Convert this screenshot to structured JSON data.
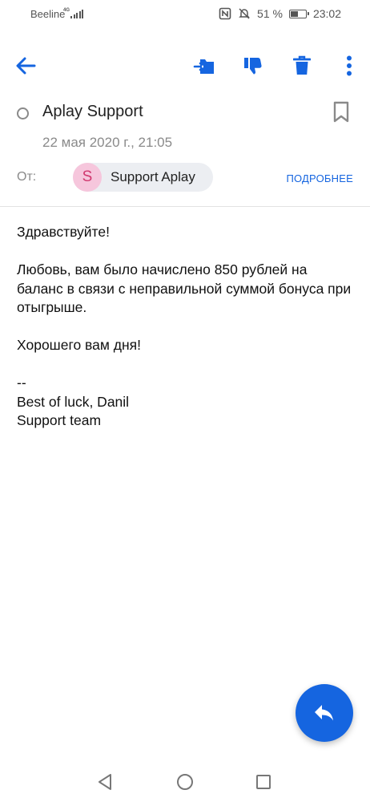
{
  "status_bar": {
    "carrier": "Beeline",
    "network": "4G",
    "nfc_icon": "nfc-icon",
    "mute_icon": "bell-off-icon",
    "battery_percent": "51 %",
    "battery_level": 0.51,
    "time": "23:02"
  },
  "toolbar": {
    "back_icon": "arrow-left-icon",
    "move_icon": "move-to-folder-icon",
    "spam_icon": "thumbs-down-icon",
    "delete_icon": "trash-icon",
    "more_icon": "more-vertical-icon"
  },
  "email": {
    "subject": "Aplay Support",
    "date": "22 мая 2020 г., 21:05",
    "from_label": "От:",
    "sender_initial": "S",
    "sender_name": "Support Aplay",
    "details_link": "ПОДРОБНЕЕ",
    "body": {
      "greeting": "Здравствуйте!",
      "paragraph": "Любовь, вам было начислено 850 рублей на баланс в связи с неправильной суммой бонуса при отыгрыше.",
      "wish": "Хорошего вам дня!",
      "sig_sep": "--",
      "sig_line1": "Best of luck, Danil",
      "sig_line2": "Support team"
    }
  },
  "fab": {
    "icon": "reply-icon"
  },
  "navbar": {
    "back_icon": "triangle-back-icon",
    "home_icon": "circle-home-icon",
    "recents_icon": "square-recents-icon"
  },
  "colors": {
    "accent": "#1565e0",
    "avatar_bg": "#f6c6dc",
    "avatar_text": "#d1386f",
    "chip_bg": "#eceef2",
    "muted_text": "#8a8a8a"
  }
}
